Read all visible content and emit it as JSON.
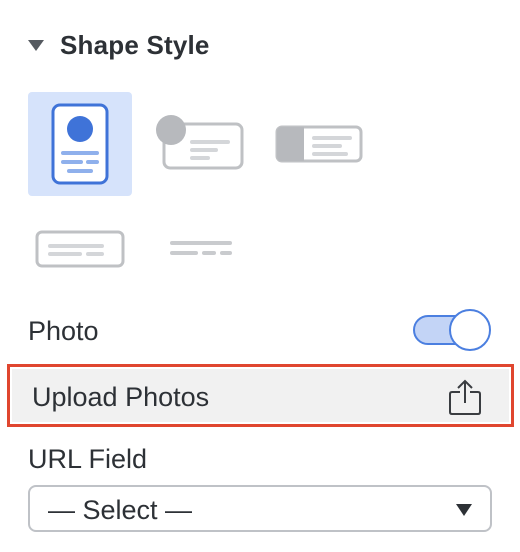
{
  "section": {
    "title": "Shape Style",
    "expanded": true
  },
  "shape_styles": [
    {
      "name": "vertical-card",
      "selected": true
    },
    {
      "name": "horizontal-card-avatar",
      "selected": false
    },
    {
      "name": "horizontal-card-split",
      "selected": false
    },
    {
      "name": "plain-card",
      "selected": false
    },
    {
      "name": "lines-only",
      "selected": false
    }
  ],
  "photo": {
    "label": "Photo",
    "enabled": true
  },
  "upload": {
    "label": "Upload Photos",
    "icon": "share-upload-icon"
  },
  "url_field": {
    "label": "URL Field",
    "selected_value": "— Select —"
  },
  "colors": {
    "accent": "#4b7fe0",
    "selected_tile": "#d6e3fb",
    "highlight_border": "#e0462f",
    "toggle_track": "#c3d4f6"
  }
}
